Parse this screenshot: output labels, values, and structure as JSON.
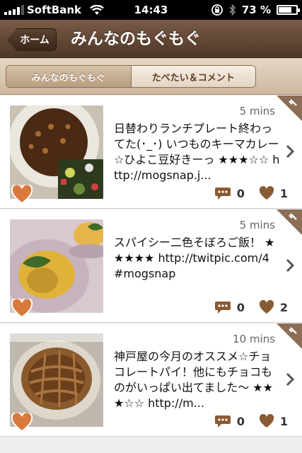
{
  "status_bar": {
    "carrier": "SoftBank",
    "time": "14:43",
    "battery_percent": 0.73,
    "battery_label": "73 %"
  },
  "nav": {
    "back_label": "ホーム",
    "title": "みんなのもぐもぐ"
  },
  "tabs": [
    {
      "label": "みんなのもぐもぐ",
      "active": true
    },
    {
      "label": "たべたい＆コメント",
      "active": false
    }
  ],
  "posts": [
    {
      "time": "5 mins",
      "text": "日替わりランチプレート終わってた(･_･) いつものキーマカレー☆ひよこ豆好きーっ ★★★☆☆ http://mogsnap.j...",
      "comments": "0",
      "likes": "1",
      "thumb_icon": "curry-photo"
    },
    {
      "time": "5 mins",
      "text": "スパイシー二色そぼろご飯！ ★★★★★ http://twitpic.com/4 #mogsnap",
      "comments": "0",
      "likes": "2",
      "thumb_icon": "soboro-rice-photo"
    },
    {
      "time": "10 mins",
      "text": "神戸屋の今月のオススメ☆チョコレートパイ！他にもチョコものがいっぱい出てました〜 ★★★☆☆ http://m...",
      "comments": "0",
      "likes": "1",
      "thumb_icon": "chocolate-pie-photo"
    }
  ],
  "colors": {
    "nav_brown": "#5e4332",
    "accent_orange": "#d97a3c",
    "icon_brown": "#8a5a33"
  }
}
